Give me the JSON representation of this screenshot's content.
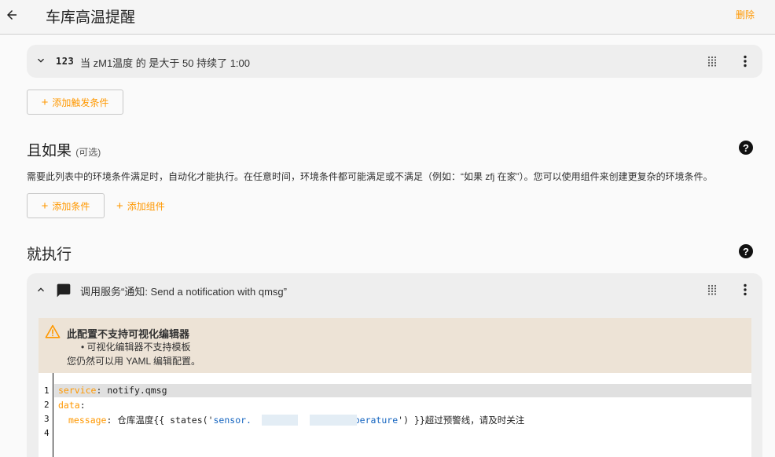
{
  "header": {
    "title": "车库高温提醒",
    "delete_label": "删除"
  },
  "trigger": {
    "icon_label": "123",
    "summary": "当 zM1温度 的 是大于 50 持续了 1:00"
  },
  "add_trigger_label": "添加触发条件",
  "conditions": {
    "title": "且如果",
    "optional": "(可选)",
    "description": "需要此列表中的环境条件满足时，自动化才能执行。在任意时间，环境条件都可能满足或不满足（例如：“如果 zfj 在家”）。您可以使用组件来创建更复杂的环境条件。",
    "add_condition_label": "添加条件",
    "add_block_label": "添加组件"
  },
  "actions": {
    "title": "就执行",
    "item_summary": "调用服务“通知: Send a notification with qmsg”",
    "warning": {
      "title": "此配置不支持可视化编辑器",
      "bullet": "可视化编辑器不支持模板",
      "note": "您仍然可以用 YAML 编辑配置。"
    },
    "code": {
      "line_numbers": [
        "1",
        "2",
        "3",
        "4"
      ],
      "line1_key": "service",
      "line1_value": " notify.qmsg",
      "line2_key": "data",
      "line3_key": "message",
      "line3_prefix": " 仓库温度{{ states('",
      "line3_entity_start": "sensor.",
      "line3_entity_end": "temperature",
      "line3_suffix": "') }}超过预警线，请及时关注"
    }
  },
  "colors": {
    "accent": "#ff9800",
    "warning_bg": "#ede3d6",
    "card_bg": "#eeeeee"
  },
  "icons": [
    "back-arrow-icon",
    "chevron-down-icon",
    "chevron-up-icon",
    "drag-handle-icon",
    "more-vert-icon",
    "help-icon",
    "message-icon",
    "warning-icon",
    "plus-icon"
  ]
}
